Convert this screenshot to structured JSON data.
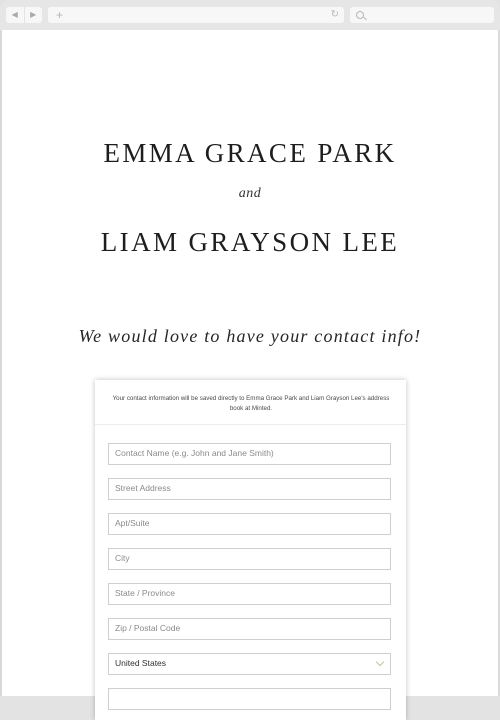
{
  "browser": {
    "nav_back_icon": "◀",
    "nav_forward_icon": "▶",
    "new_tab_icon": "+",
    "reload_icon": "↻"
  },
  "invite": {
    "name_one": "EMMA GRACE PARK",
    "connector": "and",
    "name_two": "LIAM GRAYSON LEE",
    "headline": "We would love to have your contact info!"
  },
  "form": {
    "notice": "Your contact information will be saved directly to Emma Grace Park and Liam Grayson Lee's address book at Minted.",
    "contact_name_placeholder": "Contact Name (e.g. John and Jane Smith)",
    "street_placeholder": "Street Address",
    "apt_placeholder": "Apt/Suite",
    "city_placeholder": "City",
    "state_placeholder": "State / Province",
    "zip_placeholder": "Zip / Postal Code",
    "country_selected": "United States"
  },
  "colors": {
    "accent_chevron": "#b7c79a",
    "text_dark": "#1e1e1e"
  }
}
